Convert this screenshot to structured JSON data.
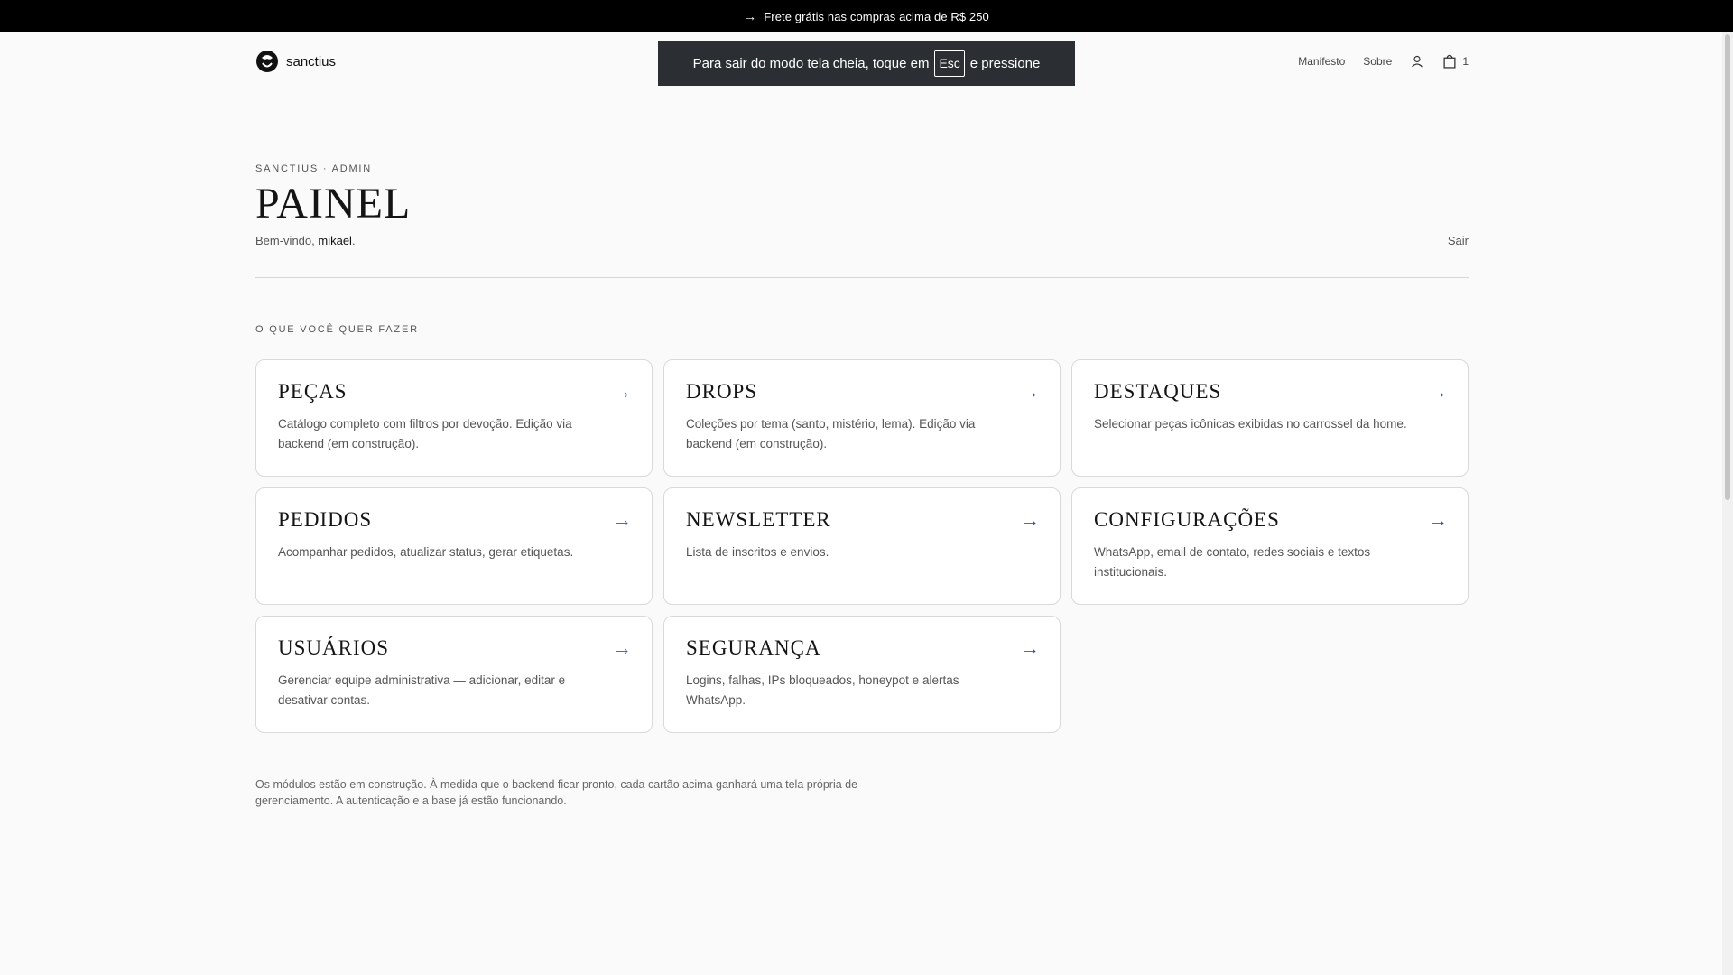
{
  "announcement": {
    "arrow": "→",
    "text": "Frete grátis nas compras acima de R$ 250"
  },
  "brand": {
    "name": "sanctius"
  },
  "nav": {
    "manifesto": "Manifesto",
    "sobre": "Sobre",
    "cart_count": "1"
  },
  "fullscreen_toast": {
    "before": "Para sair do modo tela cheia, toque em",
    "key": "Esc",
    "after": "e pressione"
  },
  "page": {
    "eyebrow": "SANCTIUS · ADMIN",
    "title": "PAINEL",
    "welcome_prefix": "Bem-vindo,",
    "username": "mikael",
    "welcome_suffix": ".",
    "logout": "Sair",
    "section_label": "O QUE VOCÊ QUER FAZER"
  },
  "cards": [
    {
      "title": "PEÇAS",
      "desc": "Catálogo completo com filtros por devoção. Edição via backend (em construção)."
    },
    {
      "title": "DROPS",
      "desc": "Coleções por tema (santo, mistério, lema). Edição via backend (em construção)."
    },
    {
      "title": "DESTAQUES",
      "desc": "Selecionar peças icônicas exibidas no carrossel da home."
    },
    {
      "title": "PEDIDOS",
      "desc": "Acompanhar pedidos, atualizar status, gerar etiquetas."
    },
    {
      "title": "NEWSLETTER",
      "desc": "Lista de inscritos e envios."
    },
    {
      "title": "CONFIGURAÇÕES",
      "desc": "WhatsApp, email de contato, redes sociais e textos institucionais."
    },
    {
      "title": "USUÁRIOS",
      "desc": "Gerenciar equipe administrativa — adicionar, editar e desativar contas."
    },
    {
      "title": "SEGURANÇA",
      "desc": "Logins, falhas, IPs bloqueados, honeypot e alertas WhatsApp."
    }
  ],
  "card_arrow": "→",
  "footnote": "Os módulos estão em construção. À medida que o backend ficar pronto, cada cartão acima ganhará uma tela própria de gerenciamento. A autenticação e a base já estão funcionando.",
  "colors": {
    "accent": "#1f5fbf",
    "topbar": "#000000",
    "toast": "#2b2f33"
  }
}
